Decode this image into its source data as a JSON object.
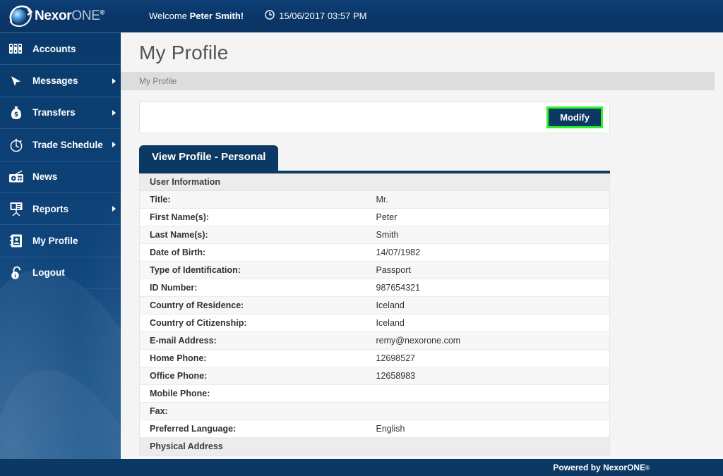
{
  "header": {
    "logo_text_primary": "Nexor",
    "logo_text_secondary": "ONE",
    "logo_registered": "®",
    "welcome_prefix": "Welcome ",
    "welcome_user": "Peter Smith!",
    "datetime": "15/06/2017 03:57 PM",
    "clock_icon": "clock-icon",
    "brand_color": "#0c3963"
  },
  "sidebar": {
    "items": [
      {
        "label": "Accounts",
        "icon": "binders-icon",
        "has_submenu": false,
        "active": false
      },
      {
        "label": "Messages",
        "icon": "cursor-icon",
        "has_submenu": true,
        "active": false
      },
      {
        "label": "Transfers",
        "icon": "money-bag-icon",
        "has_submenu": true,
        "active": false
      },
      {
        "label": "Trade Schedule",
        "icon": "stopwatch-icon",
        "has_submenu": true,
        "active": false
      },
      {
        "label": "News",
        "icon": "radio-icon",
        "has_submenu": false,
        "active": false
      },
      {
        "label": "Reports",
        "icon": "projector-icon",
        "has_submenu": true,
        "active": false
      },
      {
        "label": "My Profile",
        "icon": "address-book-icon",
        "has_submenu": false,
        "active": true
      },
      {
        "label": "Logout",
        "icon": "padlock-icon",
        "has_submenu": false,
        "active": false
      }
    ]
  },
  "main": {
    "page_title": "My Profile",
    "breadcrumb": "My Profile",
    "modify_button": "Modify",
    "modify_button_border_color": "#2bf32b",
    "tab_label": "View Profile - Personal",
    "section_user_information": "User Information",
    "section_physical_address": "Physical Address",
    "rows": [
      {
        "label": "Title:",
        "value": "Mr."
      },
      {
        "label": "First Name(s):",
        "value": "Peter"
      },
      {
        "label": "Last Name(s):",
        "value": "Smith"
      },
      {
        "label": "Date of Birth:",
        "value": "14/07/1982"
      },
      {
        "label": "Type of Identification:",
        "value": "Passport"
      },
      {
        "label": "ID Number:",
        "value": "987654321"
      },
      {
        "label": "Country of Residence:",
        "value": "Iceland"
      },
      {
        "label": "Country of Citizenship:",
        "value": "Iceland"
      },
      {
        "label": "E-mail Address:",
        "value": "remy@nexorone.com"
      },
      {
        "label": "Home Phone:",
        "value": "12698527"
      },
      {
        "label": "Office Phone:",
        "value": "12658983"
      },
      {
        "label": "Mobile Phone:",
        "value": ""
      },
      {
        "label": "Fax:",
        "value": ""
      },
      {
        "label": "Preferred Language:",
        "value": "English"
      }
    ]
  },
  "footer": {
    "text": "Powered by NexorONE",
    "registered": "®"
  }
}
